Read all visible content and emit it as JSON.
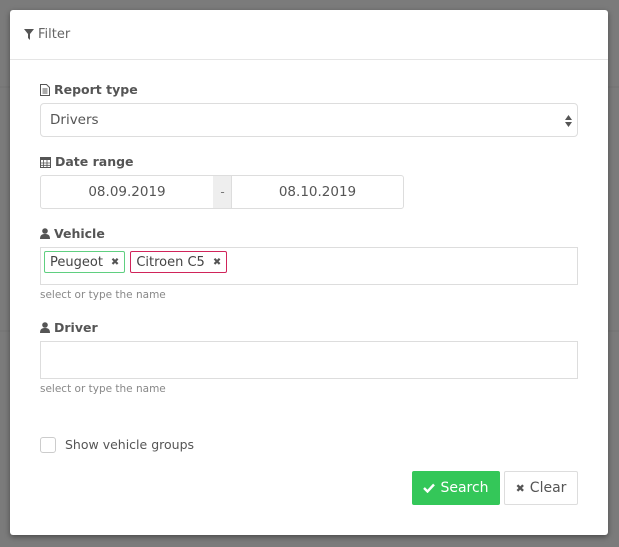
{
  "modal": {
    "title": "Filter",
    "report_type": {
      "label": "Report type",
      "value": "Drivers"
    },
    "date_range": {
      "label": "Date range",
      "from": "08.09.2019",
      "separator": "-",
      "to": "08.10.2019"
    },
    "vehicle": {
      "label": "Vehicle",
      "tags": [
        {
          "name": "Peugeot",
          "color": "#5fcf80"
        },
        {
          "name": "Citroen C5",
          "color": "#d0245a"
        }
      ],
      "help": "select or type the name"
    },
    "driver": {
      "label": "Driver",
      "value": "",
      "help": "select or type the name"
    },
    "show_groups": {
      "label": "Show vehicle groups",
      "checked": false
    },
    "search_label": "Search",
    "clear_label": "Clear",
    "accent": "#34c759"
  }
}
